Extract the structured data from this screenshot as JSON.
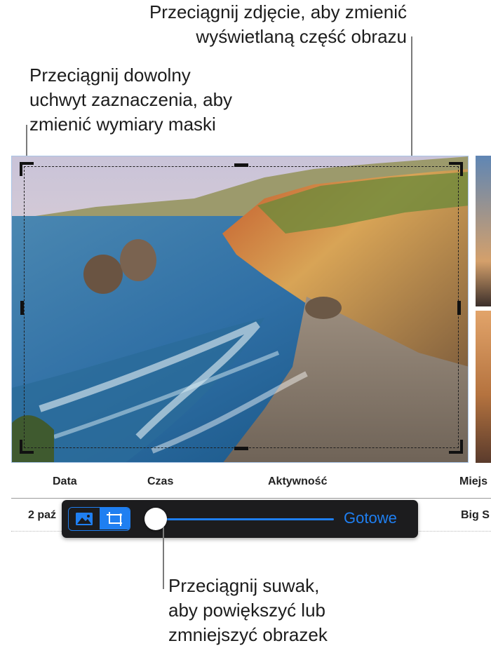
{
  "callouts": {
    "drag_photo": [
      "Przeciągnij zdjęcie, aby zmienić",
      "wyświetlaną część obrazu"
    ],
    "drag_handle": [
      "Przeciągnij dowolny",
      "uchwyt zaznaczenia, aby",
      "zmienić wymiary maski"
    ],
    "drag_slider": [
      "Przeciągnij suwak,",
      "aby powiększyć lub",
      "zmniejszyć obrazek"
    ]
  },
  "table": {
    "headers": [
      "Data",
      "Czas",
      "Aktywność",
      "Miejs"
    ],
    "row": [
      "2 paź",
      "Big S"
    ]
  },
  "toolbar": {
    "image_mode_icon": "photo-icon",
    "mask_mode_icon": "crop-mask-icon",
    "slider_value": 0.05,
    "done_label": "Gotowe"
  },
  "colors": {
    "accent": "#1f7ff1",
    "toolbar_bg": "#1c1c1e",
    "selection_border": "#a9c4e6"
  }
}
